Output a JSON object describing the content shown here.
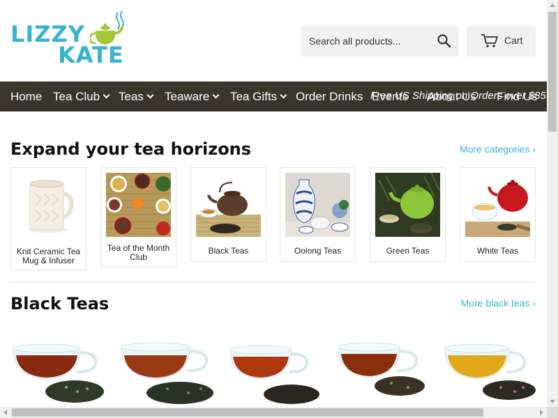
{
  "logo": {
    "line1": "LIZZY",
    "line2": "KATE"
  },
  "search": {
    "placeholder": "Search all products..."
  },
  "cart": {
    "label": "Cart"
  },
  "nav": {
    "items": [
      "Home",
      "Tea Club",
      "Teas",
      "Teaware",
      "Tea Gifts",
      "Order Drinks"
    ],
    "overlap": [
      "Events",
      "About Us",
      "Find Us"
    ],
    "promo": "Free US Shipping on Orders over $85"
  },
  "categories": {
    "title": "Expand your tea horizons",
    "more": "More categories ›",
    "items": [
      {
        "label": "Knit Ceramic Tea Mug & Infuser"
      },
      {
        "label": "Tea of the Month Club"
      },
      {
        "label": "Black Teas"
      },
      {
        "label": "Oolong Teas"
      },
      {
        "label": "Green Teas"
      },
      {
        "label": "White Teas"
      }
    ]
  },
  "black_teas": {
    "title": "Black Teas",
    "more": "More black teas ›"
  },
  "colors": {
    "accent": "#3bb3cf",
    "nav_bg": "#3c352c",
    "logo_green": "#a6c63a"
  }
}
